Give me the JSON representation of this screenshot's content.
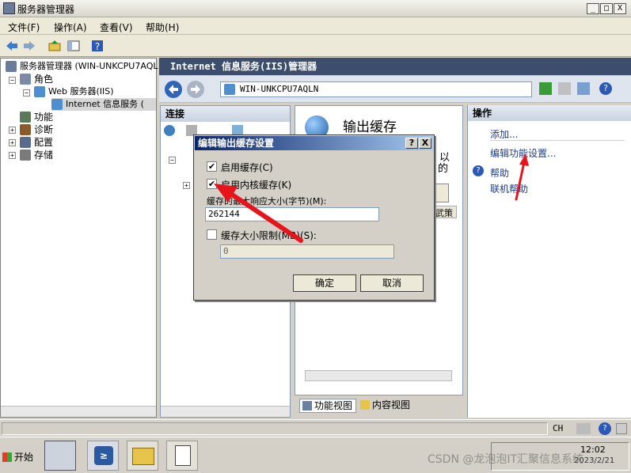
{
  "window": {
    "title": "服务器管理器",
    "controls": [
      "_",
      "□",
      "X"
    ]
  },
  "menu": [
    "文件(F)",
    "操作(A)",
    "查看(V)",
    "帮助(H)"
  ],
  "tree": {
    "root": "服务器管理器 (WIN-UNKCPU7AQL",
    "roles": "角色",
    "web_server": "Web 服务器(IIS)",
    "iis_manager": "Internet 信息服务 (",
    "features": "功能",
    "diagnostics": "诊断",
    "configuration": "配置",
    "storage": "存储"
  },
  "main": {
    "header": "Internet 信息服务(IIS)管理器",
    "address": "WIN-UNKCPU7AQLN",
    "connections_title": "连接",
    "feature_title": "输出缓存",
    "partial_text_1": "以",
    "partial_text_2": "的",
    "partial_col": "武策",
    "view_feature": "功能视图",
    "view_content": "内容视图"
  },
  "actions": {
    "title": "操作",
    "add": "添加...",
    "edit_feature_settings": "编辑功能设置...",
    "help": "帮助",
    "online_help": "联机帮助"
  },
  "dialog": {
    "title": "编辑输出缓存设置",
    "help_btn": "?",
    "close_btn": "X",
    "enable_cache": "启用缓存(C)",
    "enable_kernel_cache": "启用内核缓存(K)",
    "max_response_label": "缓存的最大响应大小(字节)(M):",
    "max_response_value": "262144",
    "cache_limit_label": "缓存大小限制(MB)(S):",
    "cache_limit_value": "0",
    "ok": "确定",
    "cancel": "取消",
    "enable_cache_checked": true,
    "enable_kernel_cache_checked": true,
    "cache_limit_checked": false
  },
  "status": {
    "lang": "CH"
  },
  "taskbar": {
    "start": "开始",
    "time": "12:02",
    "date": "2023/2/21"
  },
  "watermark": "CSDN @龙泡泡IT汇聚信息系统"
}
